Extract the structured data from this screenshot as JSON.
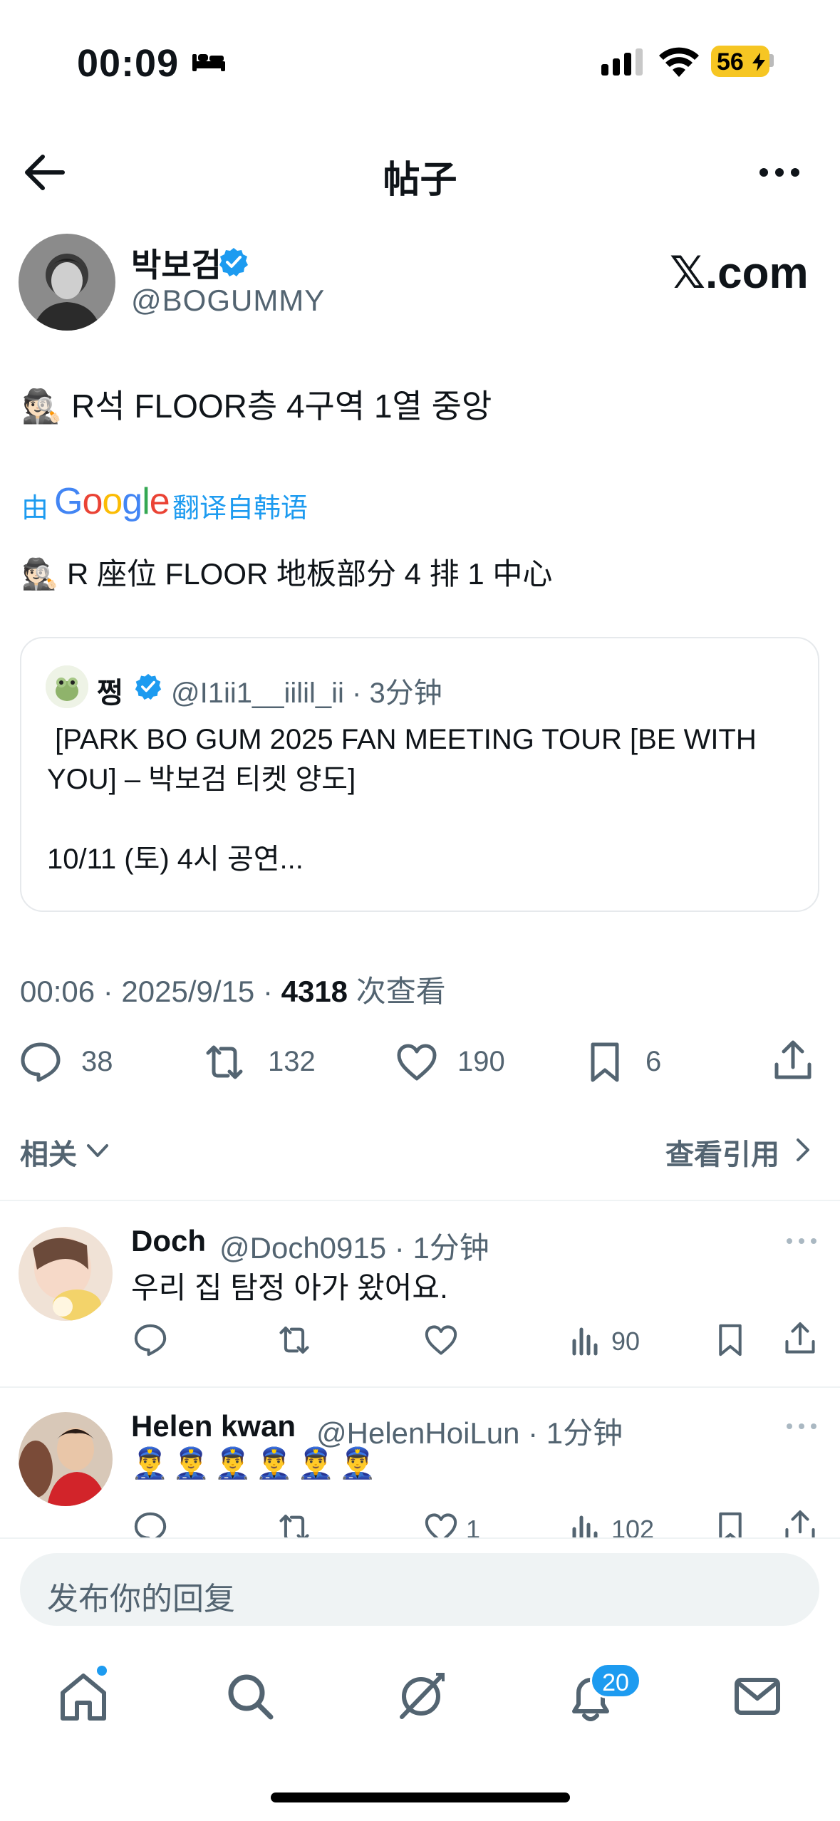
{
  "status_bar": {
    "time": "00:09",
    "battery": "56"
  },
  "header": {
    "title": "帖子"
  },
  "post": {
    "author_name": "박보검",
    "author_handle": "@BOGUMMY",
    "site_brand": "𝕏.com",
    "text_emoji": "🕵🏻",
    "text": "R석 FLOOR층 4구역 1열 중앙",
    "translate_prefix": "由",
    "translate_google": "Google",
    "translate_suffix": "翻译自韩语",
    "translated_emoji": "🕵🏻",
    "translated_text": "R 座位 FLOOR 地板部分 4 排 1 中心",
    "timestamp": "00:06 · 2025/9/15 · ",
    "views_count": "4318",
    "views_label": " 次查看"
  },
  "quote": {
    "name": "쩡",
    "meta": "@I1ii1__iilil_ii · 3分钟",
    "body": " [PARK BO GUM 2025 FAN MEETING TOUR [BE WITH YOU] – 박보검 티켓 양도]\n\n10/11 (토) 4시 공연..."
  },
  "actions": {
    "replies": "38",
    "retweets": "132",
    "likes": "190",
    "bookmarks": "6"
  },
  "related": {
    "label": "相关",
    "view_quotes": "查看引用"
  },
  "replies": [
    {
      "name": "Doch",
      "meta": "@Doch0915 · 1分钟",
      "text": "우리 집 탐정 아가 왔어요.",
      "like_count": "",
      "views": "90"
    },
    {
      "name": "Helen kwan",
      "meta": "@HelenHoiLun · 1分钟",
      "text": "👮‍♂️👮‍♂️👮‍♂️👮‍♂️👮‍♂️👮‍♂️",
      "like_count": "1",
      "views": "102"
    }
  ],
  "composer": {
    "placeholder": "发布你的回复"
  },
  "nav": {
    "notifications_badge": "20"
  },
  "colors": {
    "accent": "#1d9bf0",
    "text": "#0f1419",
    "muted": "#536471",
    "battery": "#f6c623"
  }
}
